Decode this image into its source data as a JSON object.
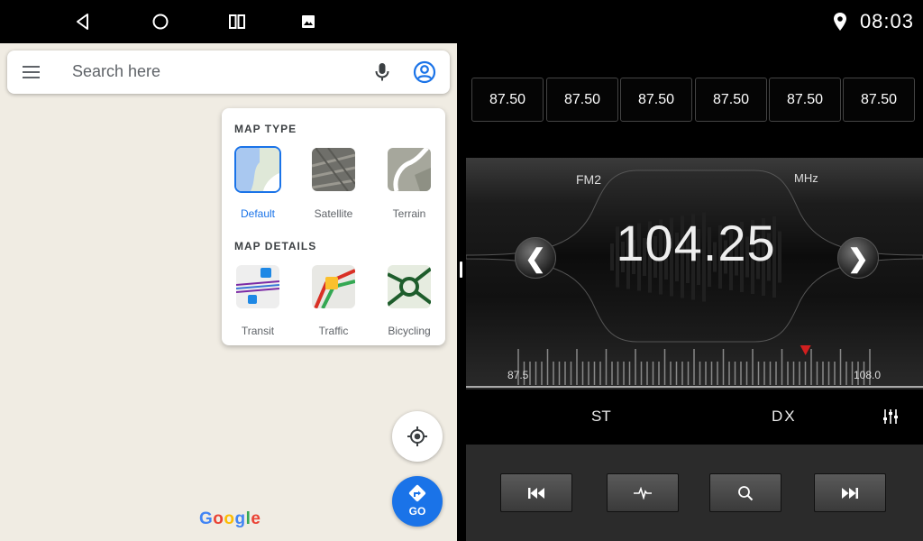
{
  "status": {
    "time": "08:03",
    "nav_icons": [
      "back-icon",
      "home-icon",
      "recents-icon",
      "gallery-icon"
    ],
    "indicators": [
      "location-pin-icon"
    ]
  },
  "maps": {
    "search": {
      "placeholder": "Search here"
    },
    "layers": {
      "map_type_title": "MAP TYPE",
      "map_types": [
        {
          "label": "Default",
          "selected": true
        },
        {
          "label": "Satellite",
          "selected": false
        },
        {
          "label": "Terrain",
          "selected": false
        }
      ],
      "map_details_title": "MAP DETAILS",
      "map_details": [
        {
          "label": "Transit"
        },
        {
          "label": "Traffic"
        },
        {
          "label": "Bicycling"
        }
      ]
    },
    "go_label": "GO",
    "logo": "Google",
    "colors": {
      "accent": "#1a73e8",
      "map_bg": "#f0ece3"
    }
  },
  "radio": {
    "presets": [
      "87.50",
      "87.50",
      "87.50",
      "87.50",
      "87.50",
      "87.50"
    ],
    "band": "FM2",
    "unit": "MHz",
    "frequency": "104.25",
    "scale_min": "87.5",
    "scale_max": "108.0",
    "tuning_marker_mhz": 104.25,
    "toolbar": {
      "st": "ST",
      "dx": "DX"
    },
    "controls": [
      "previous-icon",
      "waveform-icon",
      "search-icon",
      "next-icon"
    ],
    "colors": {
      "marker": "#d11f1f"
    }
  }
}
